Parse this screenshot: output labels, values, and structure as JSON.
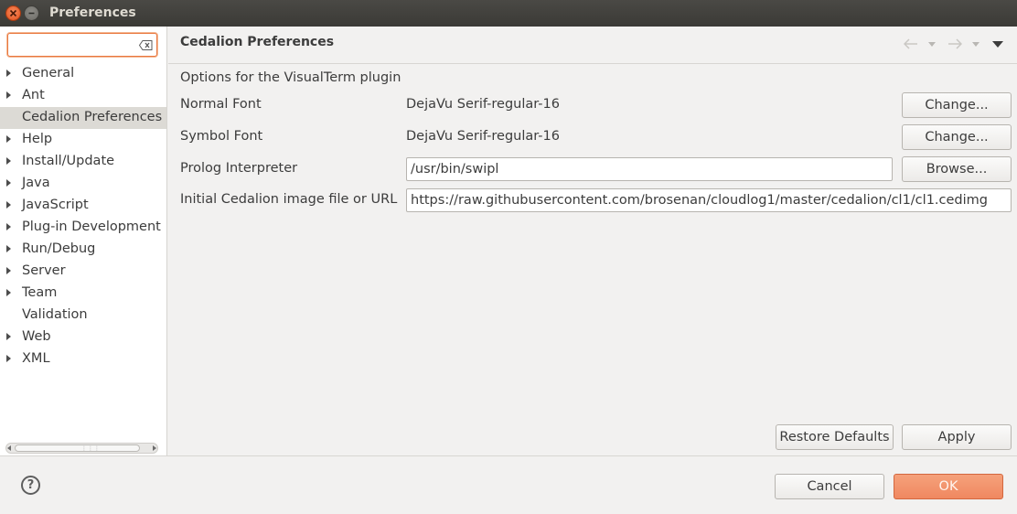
{
  "window": {
    "title": "Preferences"
  },
  "filter": {
    "value": "",
    "placeholder": ""
  },
  "tree": {
    "items": [
      {
        "label": "General",
        "has_children": true,
        "selected": false
      },
      {
        "label": "Ant",
        "has_children": true,
        "selected": false
      },
      {
        "label": "Cedalion Preferences",
        "has_children": false,
        "selected": true
      },
      {
        "label": "Help",
        "has_children": true,
        "selected": false
      },
      {
        "label": "Install/Update",
        "has_children": true,
        "selected": false
      },
      {
        "label": "Java",
        "has_children": true,
        "selected": false
      },
      {
        "label": "JavaScript",
        "has_children": true,
        "selected": false
      },
      {
        "label": "Plug-in Development",
        "has_children": true,
        "selected": false
      },
      {
        "label": "Run/Debug",
        "has_children": true,
        "selected": false
      },
      {
        "label": "Server",
        "has_children": true,
        "selected": false
      },
      {
        "label": "Team",
        "has_children": true,
        "selected": false
      },
      {
        "label": "Validation",
        "has_children": false,
        "selected": false
      },
      {
        "label": "Web",
        "has_children": true,
        "selected": false
      },
      {
        "label": "XML",
        "has_children": true,
        "selected": false
      }
    ]
  },
  "page": {
    "title": "Cedalion Preferences",
    "description": "Options for the VisualTerm plugin",
    "normal_font": {
      "label": "Normal Font",
      "value": "DejaVu Serif-regular-16",
      "button": "Change..."
    },
    "symbol_font": {
      "label": "Symbol Font",
      "value": "DejaVu Serif-regular-16",
      "button": "Change..."
    },
    "prolog": {
      "label": "Prolog Interpreter",
      "value": "/usr/bin/swipl",
      "button": "Browse..."
    },
    "image_url": {
      "label": "Initial Cedalion image file or URL",
      "value": "https://raw.githubusercontent.com/brosenan/cloudlog1/master/cedalion/cl1/cl1.cedimg"
    },
    "restore_defaults": "Restore Defaults",
    "apply": "Apply"
  },
  "footer": {
    "help": "?",
    "cancel": "Cancel",
    "ok": "OK"
  },
  "colors": {
    "accent": "#f08860",
    "focus_border": "#e9773f",
    "titlebar": "#3b3a36"
  }
}
